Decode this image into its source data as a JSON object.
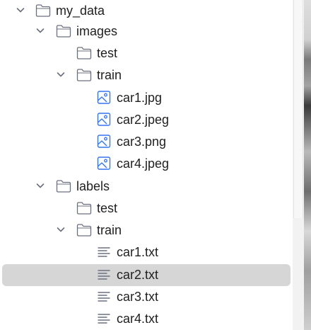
{
  "tree": {
    "items": [
      {
        "label": "my_data",
        "type": "folder",
        "expanded": true
      },
      {
        "label": "images",
        "type": "folder",
        "expanded": true
      },
      {
        "label": "test",
        "type": "folder",
        "expanded": false
      },
      {
        "label": "train",
        "type": "folder",
        "expanded": true
      },
      {
        "label": "car1.jpg",
        "type": "image-file"
      },
      {
        "label": "car2.jpeg",
        "type": "image-file"
      },
      {
        "label": "car3.png",
        "type": "image-file"
      },
      {
        "label": "car4.jpeg",
        "type": "image-file"
      },
      {
        "label": "labels",
        "type": "folder",
        "expanded": true
      },
      {
        "label": "test",
        "type": "folder",
        "expanded": false
      },
      {
        "label": "train",
        "type": "folder",
        "expanded": true
      },
      {
        "label": "car1.txt",
        "type": "text-file"
      },
      {
        "label": "car2.txt",
        "type": "text-file",
        "selected": true
      },
      {
        "label": "car3.txt",
        "type": "text-file"
      },
      {
        "label": "car4.txt",
        "type": "text-file"
      }
    ]
  },
  "colors": {
    "selection": "#d6d6d6",
    "image_icon": "#3574f0",
    "folder_icon": "#6c707e",
    "chevron": "#6c707e"
  }
}
